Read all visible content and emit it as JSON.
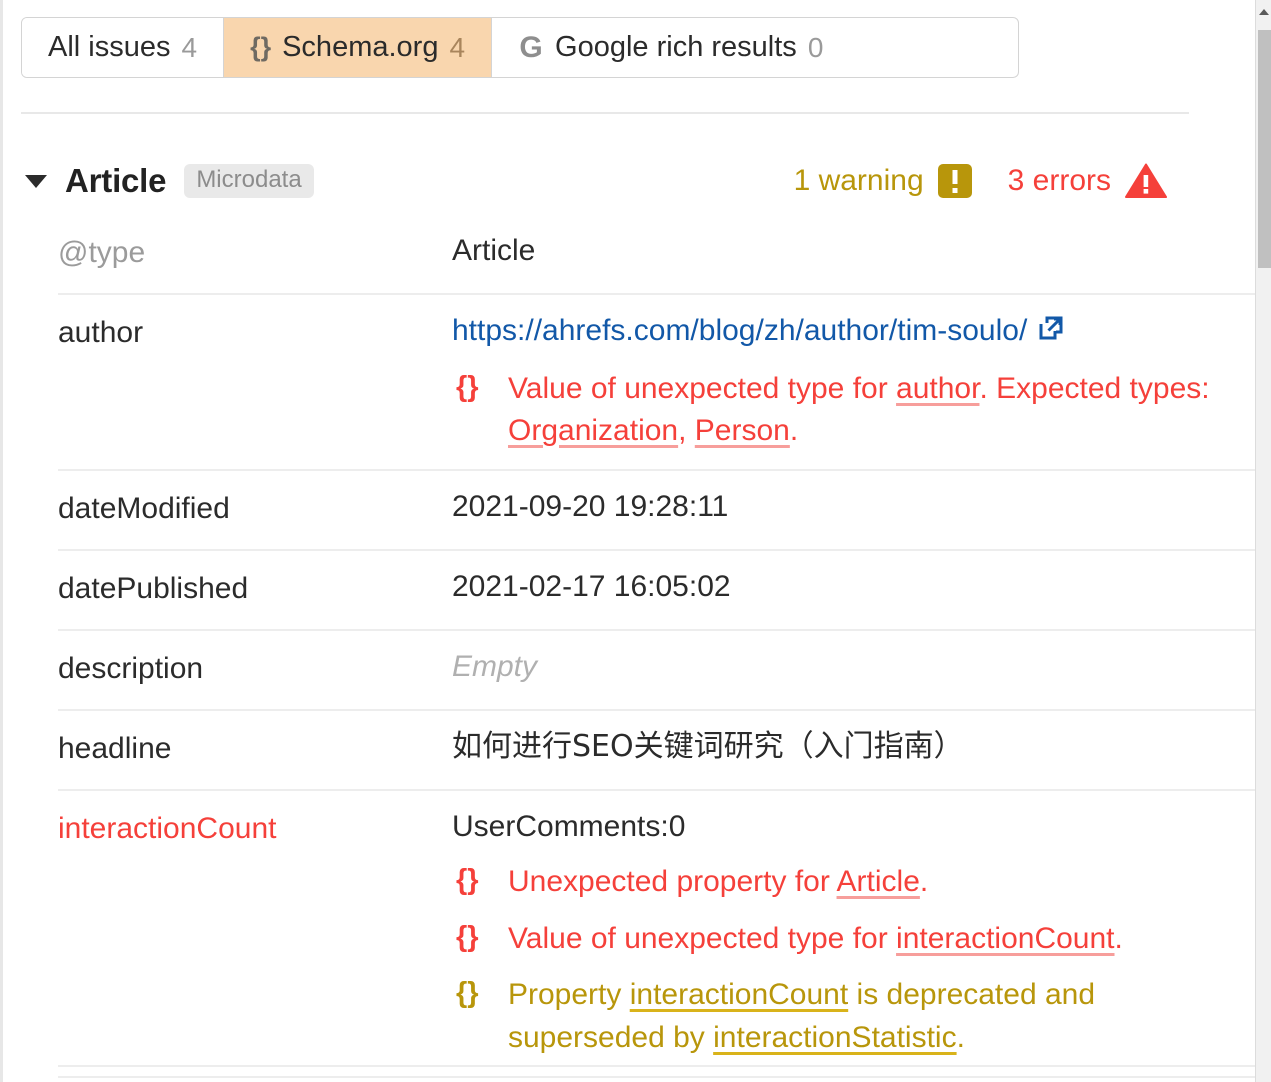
{
  "tabs": [
    {
      "label": "All issues",
      "count": "4",
      "icon": "none",
      "active": false
    },
    {
      "label": "Schema.org",
      "count": "4",
      "icon": "curly-braces-icon",
      "active": true
    },
    {
      "label": "Google rich results",
      "count": "0",
      "icon": "google-g-icon",
      "active": false
    }
  ],
  "entity": {
    "title": "Article",
    "format_badge": "Microdata",
    "warning_count_label": "1 warning",
    "error_count_label": "3 errors",
    "expanded": true
  },
  "colors": {
    "active_tab_bg": "#f9d6ae",
    "error": "#f5403a",
    "warning": "#b8960b",
    "link": "#1258a8",
    "muted": "#9b9b9b",
    "divider": "#ededed"
  },
  "properties": [
    {
      "key": "@type",
      "key_style": "muted",
      "value": "Article",
      "value_style": "plain",
      "messages": []
    },
    {
      "key": "author",
      "key_style": "plain",
      "value": "https://ahrefs.com/blog/zh/author/tim-soulo/",
      "value_style": "link",
      "external_link_icon": "external-link-icon",
      "messages": [
        {
          "severity": "error",
          "brace": "{}",
          "parts": [
            {
              "t": "Value of unexpected type for ",
              "u": false
            },
            {
              "t": "author",
              "u": true
            },
            {
              "t": ". Expected types: ",
              "u": false
            },
            {
              "t": "Organization",
              "u": true
            },
            {
              "t": ", ",
              "u": false
            },
            {
              "t": "Person",
              "u": true
            },
            {
              "t": ".",
              "u": false
            }
          ]
        }
      ]
    },
    {
      "key": "dateModified",
      "key_style": "plain",
      "value": "2021-09-20 19:28:11",
      "value_style": "plain",
      "messages": []
    },
    {
      "key": "datePublished",
      "key_style": "plain",
      "value": "2021-02-17 16:05:02",
      "value_style": "plain",
      "messages": []
    },
    {
      "key": "description",
      "key_style": "plain",
      "value": "Empty",
      "value_style": "empty",
      "messages": []
    },
    {
      "key": "headline",
      "key_style": "plain",
      "value": "如何进行SEO关键词研究（入门指南）",
      "value_style": "cjk",
      "messages": []
    },
    {
      "key": "interactionCount",
      "key_style": "error",
      "value": "UserComments:0",
      "value_style": "plain",
      "messages": [
        {
          "severity": "error",
          "brace": "{}",
          "parts": [
            {
              "t": "Unexpected property for ",
              "u": false
            },
            {
              "t": "Article",
              "u": true
            },
            {
              "t": ".",
              "u": false
            }
          ]
        },
        {
          "severity": "error",
          "brace": "{}",
          "parts": [
            {
              "t": "Value of unexpected type for ",
              "u": false
            },
            {
              "t": "interactionCount",
              "u": true
            },
            {
              "t": ".",
              "u": false
            }
          ]
        },
        {
          "severity": "warning",
          "brace": "{}",
          "parts": [
            {
              "t": "Property ",
              "u": false
            },
            {
              "t": "interactionCount",
              "u": true
            },
            {
              "t": " is deprecated and superseded by ",
              "u": false
            },
            {
              "t": "interactionStatistic",
              "u": true
            },
            {
              "t": ".",
              "u": false
            }
          ]
        }
      ]
    }
  ],
  "scrollbar": {
    "up_arrow": "scroll-up-arrow-icon",
    "thumb": "scrollbar-thumb"
  }
}
